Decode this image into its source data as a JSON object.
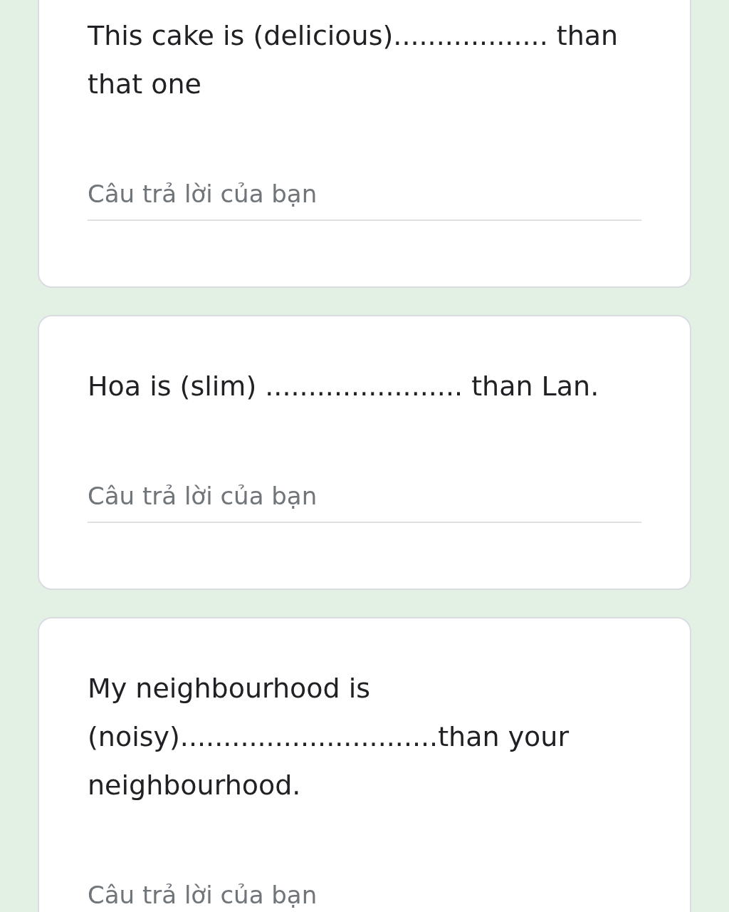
{
  "questions": [
    {
      "text": "This cake is (delicious).................. than that one",
      "placeholder": "Câu trả lời của bạn"
    },
    {
      "text": "Hoa is (slim) ....................... than Lan.",
      "placeholder": "Câu trả lời của bạn"
    },
    {
      "text": "My neighbourhood is (noisy)..............................than your neighbourhood.",
      "placeholder": "Câu trả lời của bạn"
    }
  ]
}
